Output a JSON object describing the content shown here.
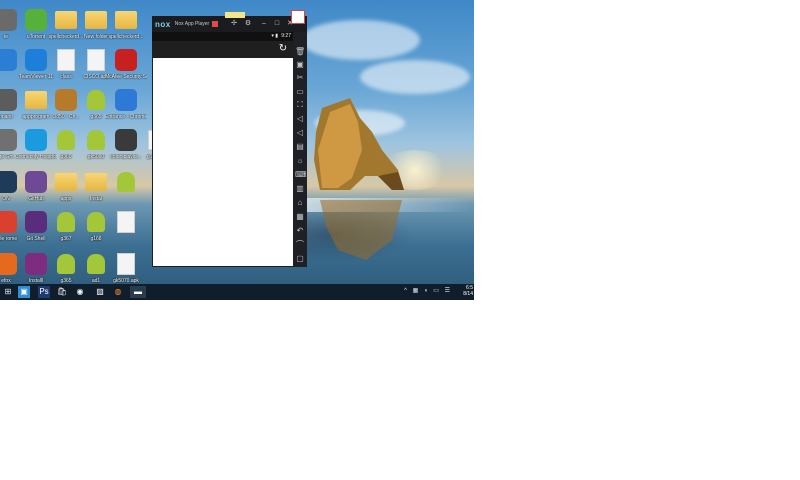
{
  "desktop_icons": [
    {
      "label": "te",
      "icon": "app-icon",
      "kind": "app",
      "color": "#6a6a6a"
    },
    {
      "label": "uTorrent",
      "icon": "utorrent-icon",
      "kind": "app",
      "color": "#57b03a"
    },
    {
      "label": "spellcheckerd...",
      "icon": "folder-icon",
      "kind": "folder"
    },
    {
      "label": "New folder",
      "icon": "folder-icon",
      "kind": "folder"
    },
    {
      "label": "spellcheckerd...",
      "icon": "folder-icon",
      "kind": "folder"
    },
    {
      "label": "",
      "icon": "app-icon",
      "kind": "app",
      "color": "#2a7fd4"
    },
    {
      "label": "TeamViewer 11",
      "icon": "teamviewer-icon",
      "kind": "app",
      "color": "#1e7fd8"
    },
    {
      "label": "class",
      "icon": "document-icon",
      "kind": "doc"
    },
    {
      "label": "CISCO.apk",
      "icon": "document-icon",
      "kind": "doc"
    },
    {
      "label": "McAfee Security Sc...",
      "icon": "mcafee-icon",
      "kind": "app",
      "color": "#c8201e"
    },
    {
      "label": "pnano",
      "icon": "app-icon",
      "kind": "app",
      "color": "#5c5c5c"
    },
    {
      "label": "appprogram",
      "icon": "folder-icon",
      "kind": "folder"
    },
    {
      "label": "O850 - Ch...",
      "icon": "app-icon",
      "kind": "app",
      "color": "#b77a2a"
    },
    {
      "label": "g365",
      "icon": "android-icon",
      "kind": "android"
    },
    {
      "label": "Entrance - Chrome",
      "icon": "entrance-icon",
      "kind": "app",
      "color": "#2d79d6"
    },
    {
      "label": "ge Gm",
      "icon": "app-icon",
      "kind": "app",
      "color": "#707070"
    },
    {
      "label": "Connectify Hotspot 2016",
      "icon": "connectify-icon",
      "kind": "app",
      "color": "#1a9be0"
    },
    {
      "label": "g360",
      "icon": "android-icon",
      "kind": "android"
    },
    {
      "label": "gk5090",
      "icon": "android-icon",
      "kind": "android"
    },
    {
      "label": "colorsplaylis...",
      "icon": "color-icon",
      "kind": "app",
      "color": "#3a3a3a"
    },
    {
      "label": "ON",
      "icon": "app-icon",
      "kind": "app",
      "color": "#1e3b5a"
    },
    {
      "label": "GitHub",
      "icon": "github-icon",
      "kind": "app",
      "color": "#6e4a96"
    },
    {
      "label": "apps",
      "icon": "folder-icon",
      "kind": "folder"
    },
    {
      "label": "Instal",
      "icon": "folder-icon",
      "kind": "folder"
    },
    {
      "label": "",
      "icon": "android-icon",
      "kind": "android"
    },
    {
      "label": "ogle rome",
      "icon": "chrome-icon",
      "kind": "app",
      "color": "#d9412e"
    },
    {
      "label": "Git Shell",
      "icon": "terminal-icon",
      "kind": "app",
      "color": "#5a2d7c"
    },
    {
      "label": "g367",
      "icon": "android-icon",
      "kind": "android"
    },
    {
      "label": "g168",
      "icon": "android-icon",
      "kind": "android"
    },
    {
      "label": "",
      "icon": "document-icon",
      "kind": "doc"
    },
    {
      "label": "efox",
      "icon": "firefox-icon",
      "kind": "app",
      "color": "#e66a1d"
    },
    {
      "label": "Installl",
      "icon": "winrar-icon",
      "kind": "app",
      "color": "#7d2c80"
    },
    {
      "label": "g365",
      "icon": "android-icon",
      "kind": "android"
    },
    {
      "label": "ad1",
      "icon": "android-icon",
      "kind": "android"
    },
    {
      "label": "gk5070.apk",
      "icon": "document-icon",
      "kind": "doc"
    }
  ],
  "right_column_icons": [
    {
      "label": "g11456",
      "icon": "document-icon",
      "kind": "doc"
    }
  ],
  "nox": {
    "logo": "nox",
    "title": "Nox App Player",
    "badge": "",
    "window_buttons": [
      "pin-icon",
      "settings-icon",
      "minimize-icon",
      "maximize-icon",
      "close-icon"
    ],
    "status_time": "9:27",
    "toolbar_menu": "•••",
    "toolbar": [
      "trash-icon",
      "screenshot-icon",
      "scissors-icon",
      "screen-icon",
      "fullscreen-icon",
      "volume-up-icon",
      "volume-down-icon",
      "apk-icon",
      "brightness-icon",
      "keyboard-icon",
      "shake-icon",
      "location-icon",
      "back-icon",
      "home-icon",
      "recent-apps-icon"
    ]
  },
  "taskbar": {
    "items": [
      "start-icon",
      "task-view-icon",
      "photoshop-icon",
      "store-icon",
      "chrome-icon",
      "photo-icon",
      "firefox-icon",
      "nox-taskbar-icon"
    ],
    "clock_time": "6:5",
    "clock_date": "8/14"
  },
  "colors": {
    "taskbar": "#101e2c",
    "nox_frame": "#1d1d22",
    "nox_logo": "#7ecfe8",
    "screen": "#ffffff"
  }
}
